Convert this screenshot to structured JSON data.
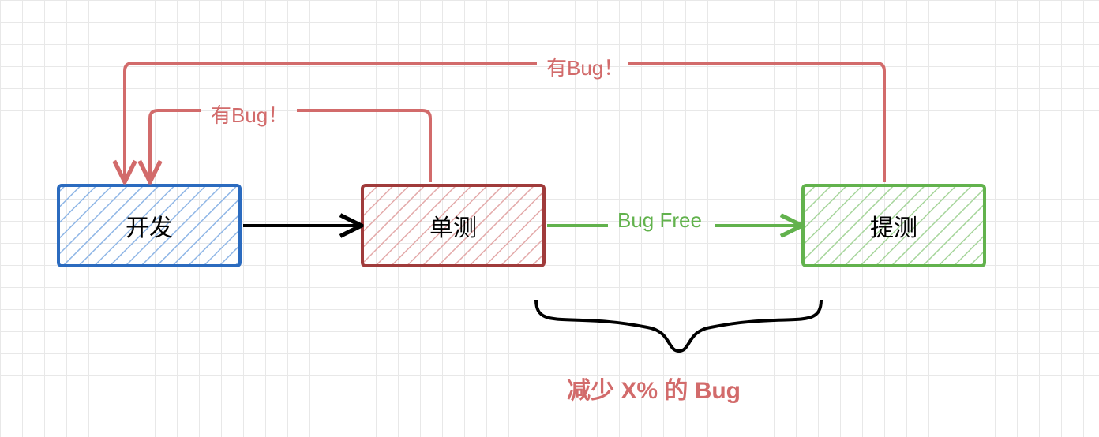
{
  "nodes": {
    "dev": {
      "label": "开发",
      "color": "#2b6bbf"
    },
    "utest": {
      "label": "单测",
      "color": "#a03b3b"
    },
    "submit": {
      "label": "提测",
      "color": "#62b24d"
    }
  },
  "edges": {
    "dev_to_utest": {
      "label": "",
      "color": "#000000"
    },
    "utest_to_submit": {
      "label": "Bug Free",
      "color": "#62b24d"
    },
    "utest_to_dev": {
      "label": "有Bug！",
      "color": "#d26b6b"
    },
    "submit_to_dev": {
      "label": "有Bug！",
      "color": "#d26b6b"
    }
  },
  "annotation": {
    "label": "减少 X% 的 Bug",
    "color": "#d26b6b"
  }
}
